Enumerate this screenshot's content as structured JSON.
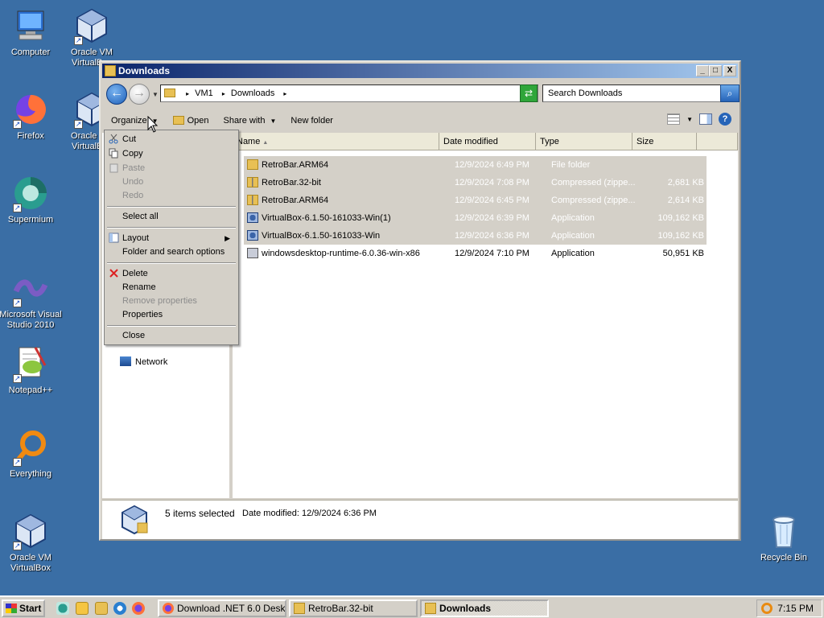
{
  "desktop": {
    "icons": [
      {
        "label": "Computer"
      },
      {
        "label": "Oracle VM VirtualBox"
      },
      {
        "label": "Firefox"
      },
      {
        "label": "Oracle VM VirtualBox"
      },
      {
        "label": "Supermium"
      },
      {
        "label": "Microsoft Visual Studio 2010"
      },
      {
        "label": "Notepad++"
      },
      {
        "label": "Everything"
      },
      {
        "label": "Oracle VM VirtualBox"
      },
      {
        "label": "Recycle Bin"
      }
    ]
  },
  "window": {
    "title": "Downloads",
    "buttons": {
      "minimize": "_",
      "maximize": "□",
      "close": "X"
    }
  },
  "address": {
    "crumbs": [
      "VM1",
      "Downloads"
    ]
  },
  "search": {
    "placeholder": "Search Downloads"
  },
  "commandbar": {
    "organize": "Organize",
    "open": "Open",
    "share_with": "Share with",
    "new_folder": "New folder"
  },
  "columns": {
    "name": "Name",
    "date": "Date modified",
    "type": "Type",
    "size": "Size"
  },
  "files": [
    {
      "name": "RetroBar.ARM64",
      "date": "12/9/2024 6:49 PM",
      "type": "File folder",
      "size": "",
      "icon": "folder-icon"
    },
    {
      "name": "RetroBar.32-bit",
      "date": "12/9/2024 7:08 PM",
      "type": "Compressed (zippe...",
      "size": "2,681 KB",
      "icon": "zip-folder-icon"
    },
    {
      "name": "RetroBar.ARM64",
      "date": "12/9/2024 6:45 PM",
      "type": "Compressed (zippe...",
      "size": "2,614 KB",
      "icon": "zip-folder-icon"
    },
    {
      "name": "VirtualBox-6.1.50-161033-Win(1)",
      "date": "12/9/2024 6:39 PM",
      "type": "Application",
      "size": "109,162 KB",
      "icon": "virtualbox-app-icon"
    },
    {
      "name": "VirtualBox-6.1.50-161033-Win",
      "date": "12/9/2024 6:36 PM",
      "type": "Application",
      "size": "109,162 KB",
      "icon": "virtualbox-app-icon"
    },
    {
      "name": "windowsdesktop-runtime-6.0.36-win-x86",
      "date": "12/9/2024 7:10 PM",
      "type": "Application",
      "size": "50,951 KB",
      "icon": "installer-app-icon"
    }
  ],
  "nav_tree": {
    "network": "Network"
  },
  "details": {
    "selection": "5 items selected",
    "date_modified": "Date modified: 12/9/2024 6:36 PM"
  },
  "organize_menu": {
    "cut": "Cut",
    "copy": "Copy",
    "paste": "Paste",
    "undo": "Undo",
    "redo": "Redo",
    "select_all": "Select all",
    "layout": "Layout",
    "folder_options": "Folder and search options",
    "delete": "Delete",
    "rename": "Rename",
    "remove_properties": "Remove properties",
    "properties": "Properties",
    "close": "Close"
  },
  "taskbar": {
    "start": "Start",
    "tasks": [
      {
        "label": "Download .NET 6.0 Deskt..."
      },
      {
        "label": "RetroBar.32-bit"
      },
      {
        "label": "Downloads"
      }
    ],
    "clock": "7:15 PM"
  }
}
